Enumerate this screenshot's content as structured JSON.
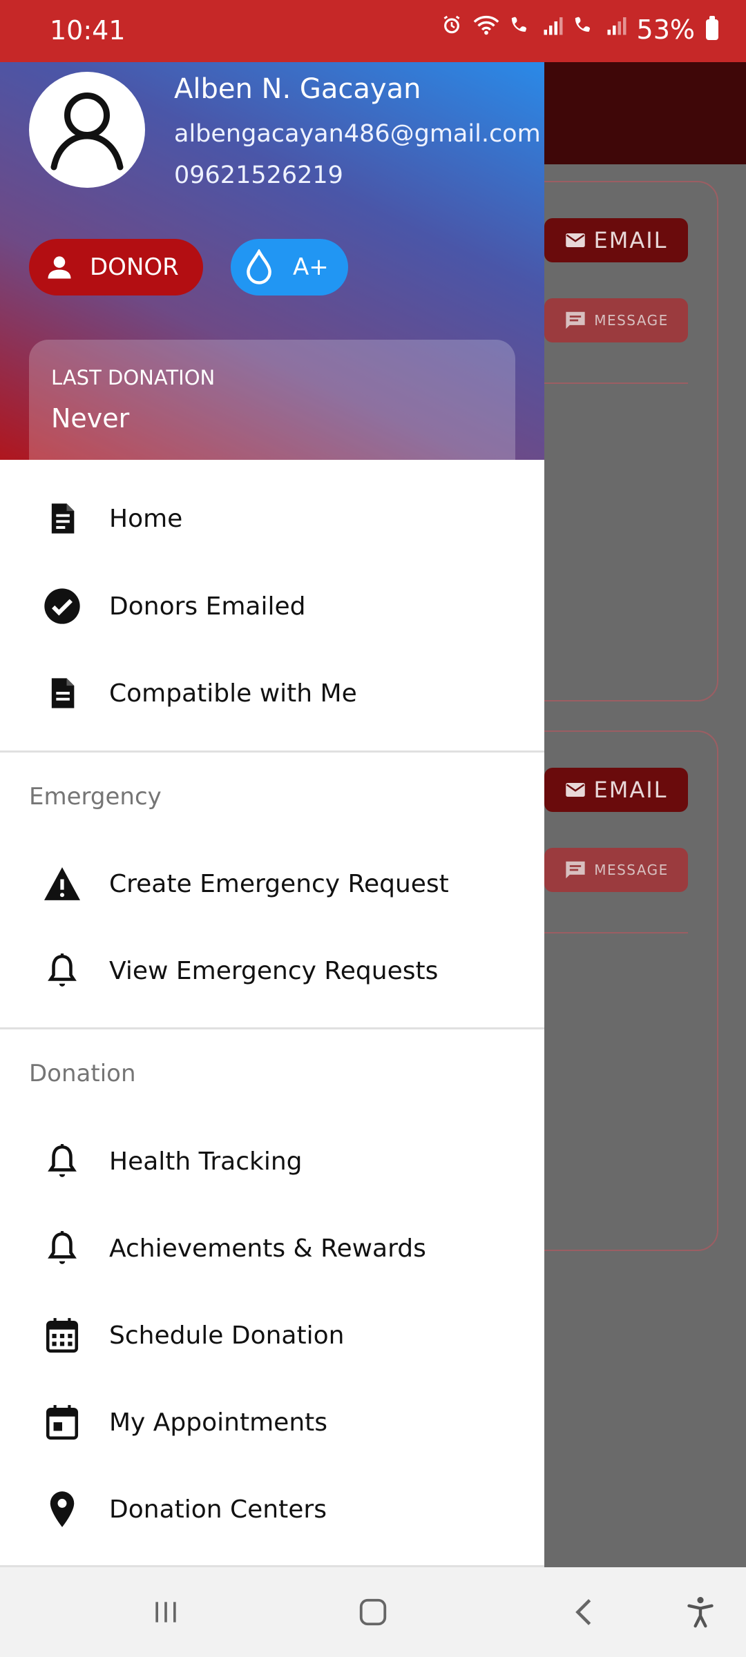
{
  "status_bar": {
    "time": "10:41",
    "battery": "53%",
    "icons": [
      "alarm-icon",
      "wifi-icon",
      "wifi-call-icon",
      "signal-icon",
      "wifi-call-icon",
      "signal-icon",
      "battery-icon"
    ]
  },
  "background": {
    "email_label": "EMAIL",
    "message_label": "MESSAGE"
  },
  "drawer": {
    "header": {
      "name": "Alben N. Gacayan",
      "email": "albengacayan486@gmail.com",
      "phone": "09621526219",
      "role_chip": "DONOR",
      "blood_type": "A+",
      "last_donation_label": "LAST DONATION",
      "last_donation_value": "Never"
    },
    "main_items": [
      {
        "label": "Home",
        "icon": "document-icon"
      },
      {
        "label": "Donors Emailed",
        "icon": "check-circle-icon"
      },
      {
        "label": "Compatible with Me",
        "icon": "description-icon"
      }
    ],
    "emergency": {
      "title": "Emergency",
      "items": [
        {
          "label": "Create Emergency Request",
          "icon": "warning-icon"
        },
        {
          "label": "View Emergency Requests",
          "icon": "bell-icon"
        }
      ]
    },
    "donation": {
      "title": "Donation",
      "items": [
        {
          "label": "Health Tracking",
          "icon": "bell-icon"
        },
        {
          "label": "Achievements & Rewards",
          "icon": "bell-icon"
        },
        {
          "label": "Schedule Donation",
          "icon": "calendar-grid-icon"
        },
        {
          "label": "My Appointments",
          "icon": "calendar-event-icon"
        },
        {
          "label": "Donation Centers",
          "icon": "location-pin-icon"
        }
      ]
    }
  },
  "nav_bar": {
    "items": [
      "recent-apps-icon",
      "home-icon",
      "back-icon",
      "accessibility-icon"
    ]
  },
  "colors": {
    "status_bar": "#c62828",
    "donor_chip": "#b30e12",
    "blood_chip": "#2196f3",
    "header_gradient_top": "#2a8ae8",
    "header_gradient_bottom": "#b0161e"
  }
}
